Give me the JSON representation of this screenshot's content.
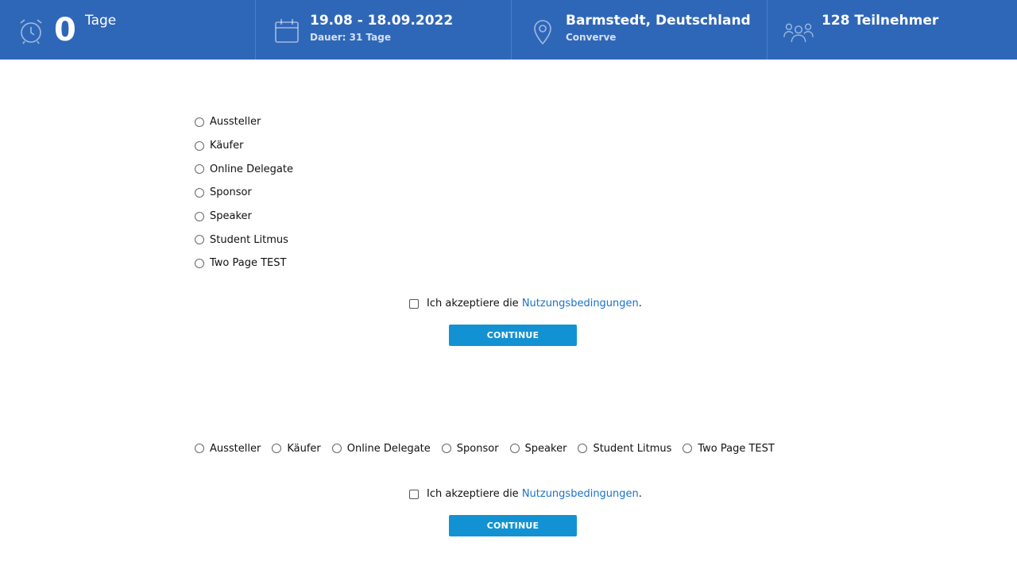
{
  "header": {
    "countdown": {
      "value": "0",
      "unit": "Tage",
      "icon": "alarm-clock-icon"
    },
    "dates": {
      "range": "19.08 - 18.09.2022",
      "duration": "Dauer: 31 Tage",
      "icon": "calendar-icon"
    },
    "location": {
      "place": "Barmstedt, Deutschland",
      "venue": "Converve",
      "icon": "map-pin-icon"
    },
    "participants": {
      "label": "128 Teilnehmer",
      "icon": "users-icon"
    },
    "bar_color": "#2f67b8"
  },
  "form1": {
    "options": [
      "Aussteller",
      "Käufer",
      "Online Delegate",
      "Sponsor",
      "Speaker",
      "Student Litmus",
      "Two Page TEST"
    ],
    "terms_prefix": "Ich akzeptiere die ",
    "terms_link": "Nutzungsbedingungen",
    "terms_suffix": ".",
    "button": "CONTINUE"
  },
  "form2": {
    "options": [
      "Aussteller",
      "Käufer",
      "Online Delegate",
      "Sponsor",
      "Speaker",
      "Student Litmus",
      "Two Page TEST"
    ],
    "terms_prefix": "Ich akzeptiere die ",
    "terms_link": "Nutzungsbedingungen",
    "terms_suffix": ".",
    "button": "CONTINUE"
  },
  "button_color": "#1392d3",
  "link_color": "#1a73c9"
}
